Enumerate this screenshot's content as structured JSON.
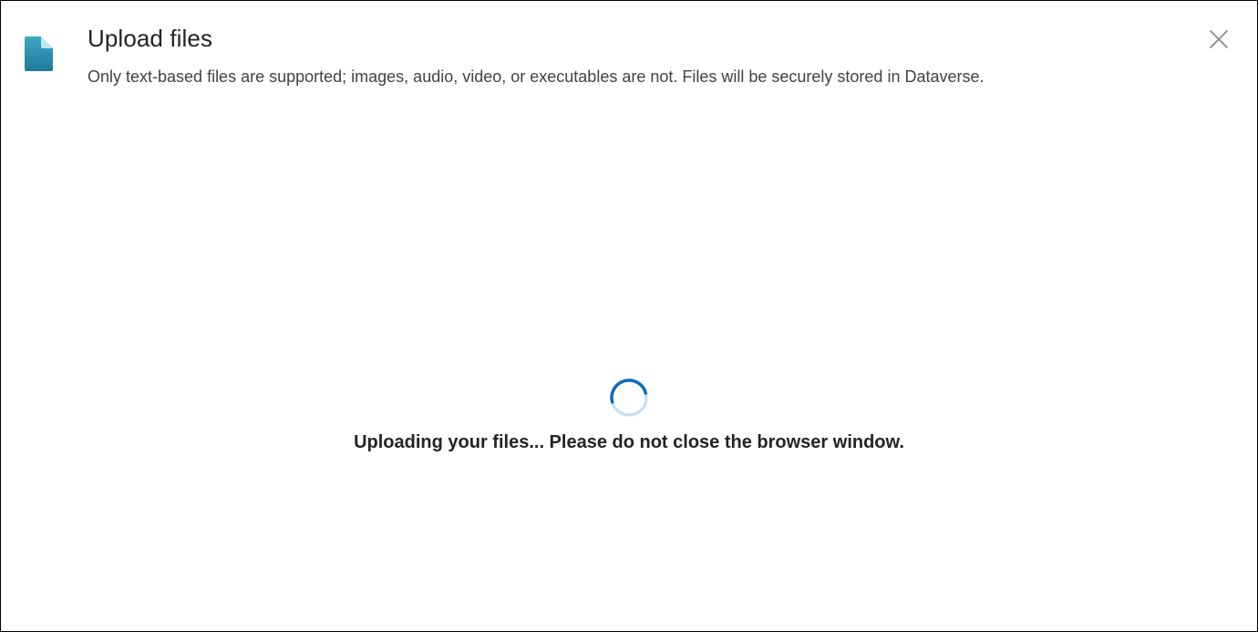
{
  "dialog": {
    "title": "Upload files",
    "subtitle": "Only text-based files are supported; images, audio, video, or executables are not. Files will be securely stored in Dataverse.",
    "header_icon": "document-icon",
    "close_icon": "close-icon"
  },
  "status": {
    "message": "Uploading your files... Please do not close the browser window.",
    "indicator_icon": "spinner-icon"
  },
  "colors": {
    "icon_gradient_start": "#3ea8c4",
    "icon_gradient_end": "#1f7a99",
    "spinner_track": "#c7e0f4",
    "spinner_arc": "#0f6cbd",
    "close_icon": "#8a8a8a",
    "title_text": "#242424",
    "subtitle_text": "#424242"
  }
}
